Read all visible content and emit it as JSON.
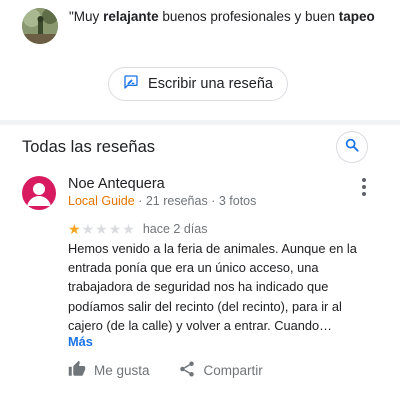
{
  "snippet": {
    "quote_open": "\"",
    "word1": "Muy",
    "word2": "relajante",
    "word3": "buenos profesionales y buen",
    "word4": "tapeo"
  },
  "write_review": {
    "label": "Escribir una reseña",
    "icon": "rate-review-icon"
  },
  "all_reviews": {
    "title": "Todas las reseñas",
    "search_icon": "search-icon"
  },
  "review": {
    "author": "Noe Antequera",
    "badge": "Local Guide",
    "separator": "·",
    "reviews_count": "21 reseñas",
    "photos_count": "3 fotos",
    "rating": 1,
    "max_rating": 5,
    "date": "hace 2 días",
    "body_lines": [
      "Hemos venido a la feria de animales. Aunque en la",
      "entrada ponía que era un único acceso, una",
      "trabajadora de seguridad nos ha indicado que",
      "podíamos salir del recinto (del recinto), para ir al",
      "cajero (de la calle) y volver a entrar. Cuando…"
    ],
    "more_label": "Más",
    "like_label": "Me gusta",
    "share_label": "Compartir",
    "icons": {
      "like": "thumb-up-icon",
      "share": "share-icon",
      "menu": "more-vert-icon"
    }
  },
  "colors": {
    "star_on": "#f4a523",
    "star_off": "#dadce0",
    "local_guide": "#e37400",
    "link": "#1a73e8",
    "avatar": "#d81b60"
  }
}
